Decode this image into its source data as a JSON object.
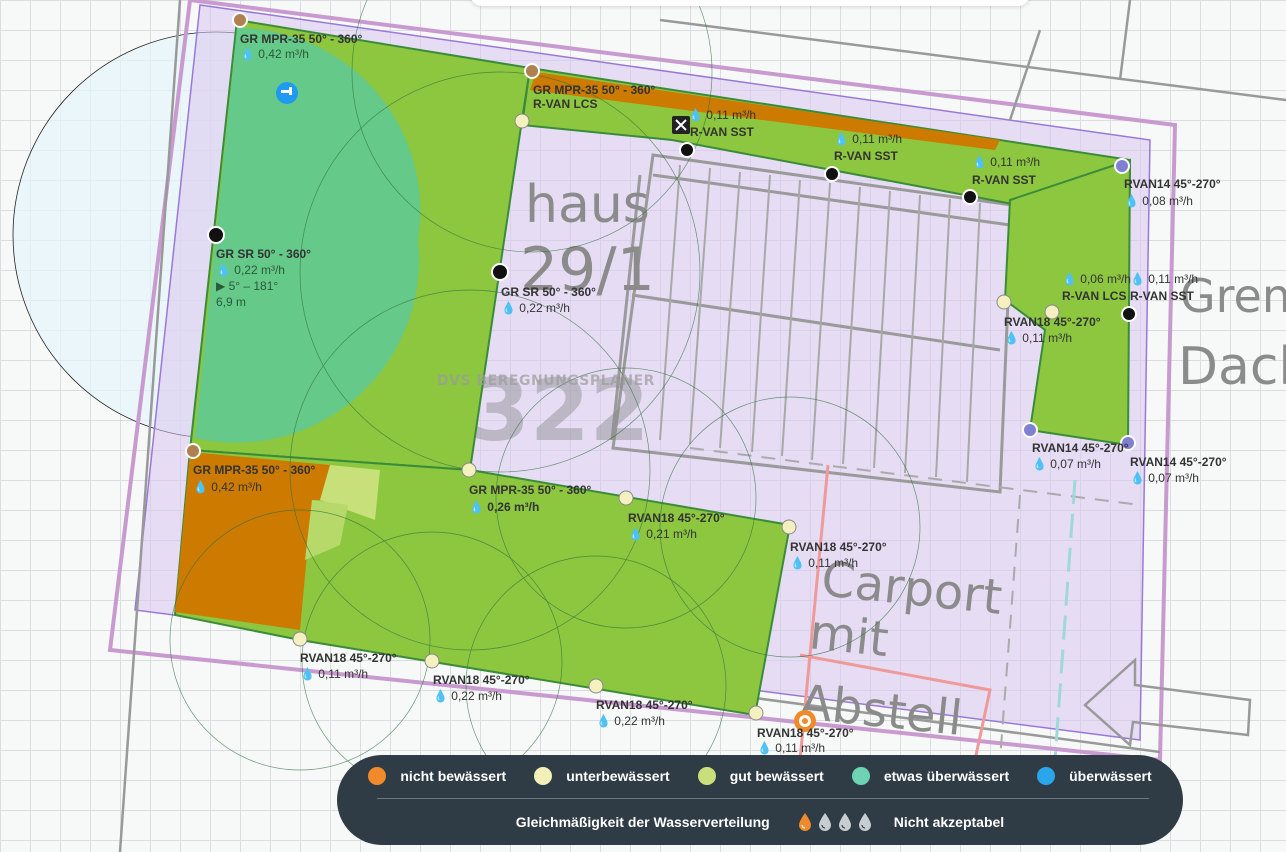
{
  "watermark": "DVS BEREGNUNGSPLANER",
  "plan_text": {
    "haus": "haus",
    "number": "29/1",
    "parcel": "322",
    "grenz": "Grenz",
    "dach": "Dach",
    "carport": "Carport",
    "mit": "mit",
    "abstell": "Abstell"
  },
  "sprinklers": [
    {
      "name": "GR MPR-35 50° - 360°",
      "flow": "0,42 m³/h"
    },
    {
      "name": "GR MPR-35 50° - 360°",
      "flow": ""
    },
    {
      "name": "R-VAN LCS",
      "flow": "0,11 m³/h"
    },
    {
      "name": "R-VAN SST",
      "flow": "0,11 m³/h"
    },
    {
      "name": "R-VAN SST",
      "flow": "0,11 m³/h"
    },
    {
      "name": "R-VAN SST",
      "flow": ""
    },
    {
      "name": "RVAN14 45°-270°",
      "flow": "0,08 m³/h"
    },
    {
      "name": "GR SR 50° - 360°",
      "flow": "0,22 m³/h",
      "arc": "5° – 181°",
      "radius": "6,9 m"
    },
    {
      "name": "GR SR 50° - 360°",
      "flow": "0,22 m³/h"
    },
    {
      "name": "R-VAN LCS",
      "flow": "0,06 m³/h"
    },
    {
      "name": "R-VAN SST",
      "flow": "0,11 m³/h"
    },
    {
      "name": "RVAN18 45°-270°",
      "flow": "0,11 m³/h"
    },
    {
      "name": "RVAN14 45°-270°",
      "flow": "0,07 m³/h"
    },
    {
      "name": "RVAN14 45°-270°",
      "flow": "0,07 m³/h"
    },
    {
      "name": "GR MPR-35 50° - 360°",
      "flow": "0,42 m³/h"
    },
    {
      "name": "GR MPR-35 50° - 360°",
      "flow": "0,26 m³/h"
    },
    {
      "name": "RVAN18 45°-270°",
      "flow": "0,21 m³/h"
    },
    {
      "name": "RVAN18 45°-270°",
      "flow": "0,11 m³/h"
    },
    {
      "name": "RVAN18 45°-270°",
      "flow": "0,11 m³/h"
    },
    {
      "name": "RVAN18 45°-270°",
      "flow": "0,22 m³/h"
    },
    {
      "name": "RVAN18 45°-270°",
      "flow": "0,22 m³/h"
    },
    {
      "name": "RVAN18 45°-270°",
      "flow": "0,11 m³/h"
    }
  ],
  "legend": {
    "items": [
      {
        "label": "nicht bewässert",
        "color": "#f08a2a"
      },
      {
        "label": "unterbewässert",
        "color": "#f2f0b8"
      },
      {
        "label": "gut bewässert",
        "color": "#c9df7e"
      },
      {
        "label": "etwas überwässert",
        "color": "#6dd3b3"
      },
      {
        "label": "überwässert",
        "color": "#2aa6ea"
      }
    ],
    "uniformity_label": "Gleichmäßigkeit der Wasserverteilung",
    "uniformity_level": 1,
    "uniformity_max": 4,
    "uniformity_text": "Nicht akzeptabel"
  },
  "colors": {
    "lawn_green": "#8dc63f",
    "dry_orange": "#cc7a00",
    "wet_teal": "#5ec996",
    "boundary_purple": "#b38fd6",
    "accent_blue": "#1e9bf0",
    "accent_orange": "#f08a2a"
  }
}
